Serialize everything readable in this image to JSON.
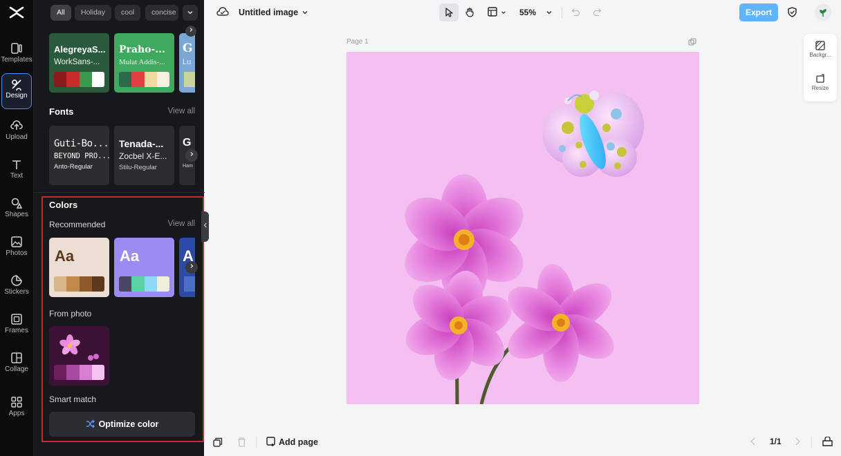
{
  "rail": {
    "items": [
      {
        "label": "Templates"
      },
      {
        "label": "Design"
      },
      {
        "label": "Upload"
      },
      {
        "label": "Text"
      },
      {
        "label": "Shapes"
      },
      {
        "label": "Photos"
      },
      {
        "label": "Stickers"
      },
      {
        "label": "Frames"
      },
      {
        "label": "Collage"
      },
      {
        "label": "Apps"
      }
    ]
  },
  "panel": {
    "chips": [
      "All",
      "Holiday",
      "cool",
      "concise"
    ],
    "font_pairs": [
      {
        "heading": "AlegreyaS...",
        "body": "WorkSans-...",
        "bg": "#2a5a3c",
        "swatches": [
          "#8b1a1a",
          "#c92b2b",
          "#3c9a4e",
          "#ffffff"
        ]
      },
      {
        "heading": "Praho-...",
        "body": "Mulat Addis-...",
        "bg": "#3fa95f",
        "swatches": [
          "#2b6b4a",
          "#e04040",
          "#f0d9a0",
          "#f5f0df"
        ]
      },
      {
        "heading": "G",
        "body": "Lu",
        "bg": "#7aa7d6",
        "swatches": [
          "#c9d29a"
        ]
      }
    ],
    "fonts": {
      "title": "Fonts",
      "view_all": "View all",
      "cards": [
        {
          "line1": "Guti-Bo...",
          "line2": "BEYOND PRO...",
          "line3": "Anto-Regular"
        },
        {
          "line1": "Tenada-...",
          "line2": "Zocbel X-E...",
          "line3": "Stilu-Regular"
        },
        {
          "line1": "G",
          "line2": "",
          "line3": "Ham"
        }
      ]
    },
    "colors": {
      "title": "Colors",
      "recommended": "Recommended",
      "view_all": "View all",
      "cards": [
        {
          "text": "Aa",
          "bg": "#ebdfd3",
          "text_color": "#5a3a1c",
          "swatches": [
            "#d7b48a",
            "#c08a4a",
            "#8c5a2b",
            "#5c3a1e"
          ]
        },
        {
          "text": "Aa",
          "bg": "#9b8cf2",
          "text_color": "#ffffff",
          "swatches": [
            "#4c4663",
            "#5ad1a4",
            "#8fd8f8",
            "#f0efd9"
          ]
        },
        {
          "text": "A",
          "bg": "#2d4aa8",
          "text_color": "#ffffff",
          "swatches": [
            "#4a6fc4"
          ]
        }
      ],
      "from_photo": "From photo",
      "photo_swatches": [
        "#6e1f5e",
        "#a74aa0",
        "#d77fd0",
        "#f4c3f1"
      ],
      "smart_match": "Smart match",
      "optimize_label": "Optimize color"
    }
  },
  "topbar": {
    "title": "Untitled image",
    "zoom": "55%",
    "export": "Export"
  },
  "canvas": {
    "page_label": "Page 1",
    "background": "#f3c0f1"
  },
  "right_tools": {
    "background": "Backgr...",
    "resize": "Resize"
  },
  "bottombar": {
    "add_page": "Add page",
    "page_count": "1/1"
  },
  "colors": {
    "accent": "#4e8df7",
    "export": "#5fb4fb",
    "highlight": "#c7282b"
  }
}
